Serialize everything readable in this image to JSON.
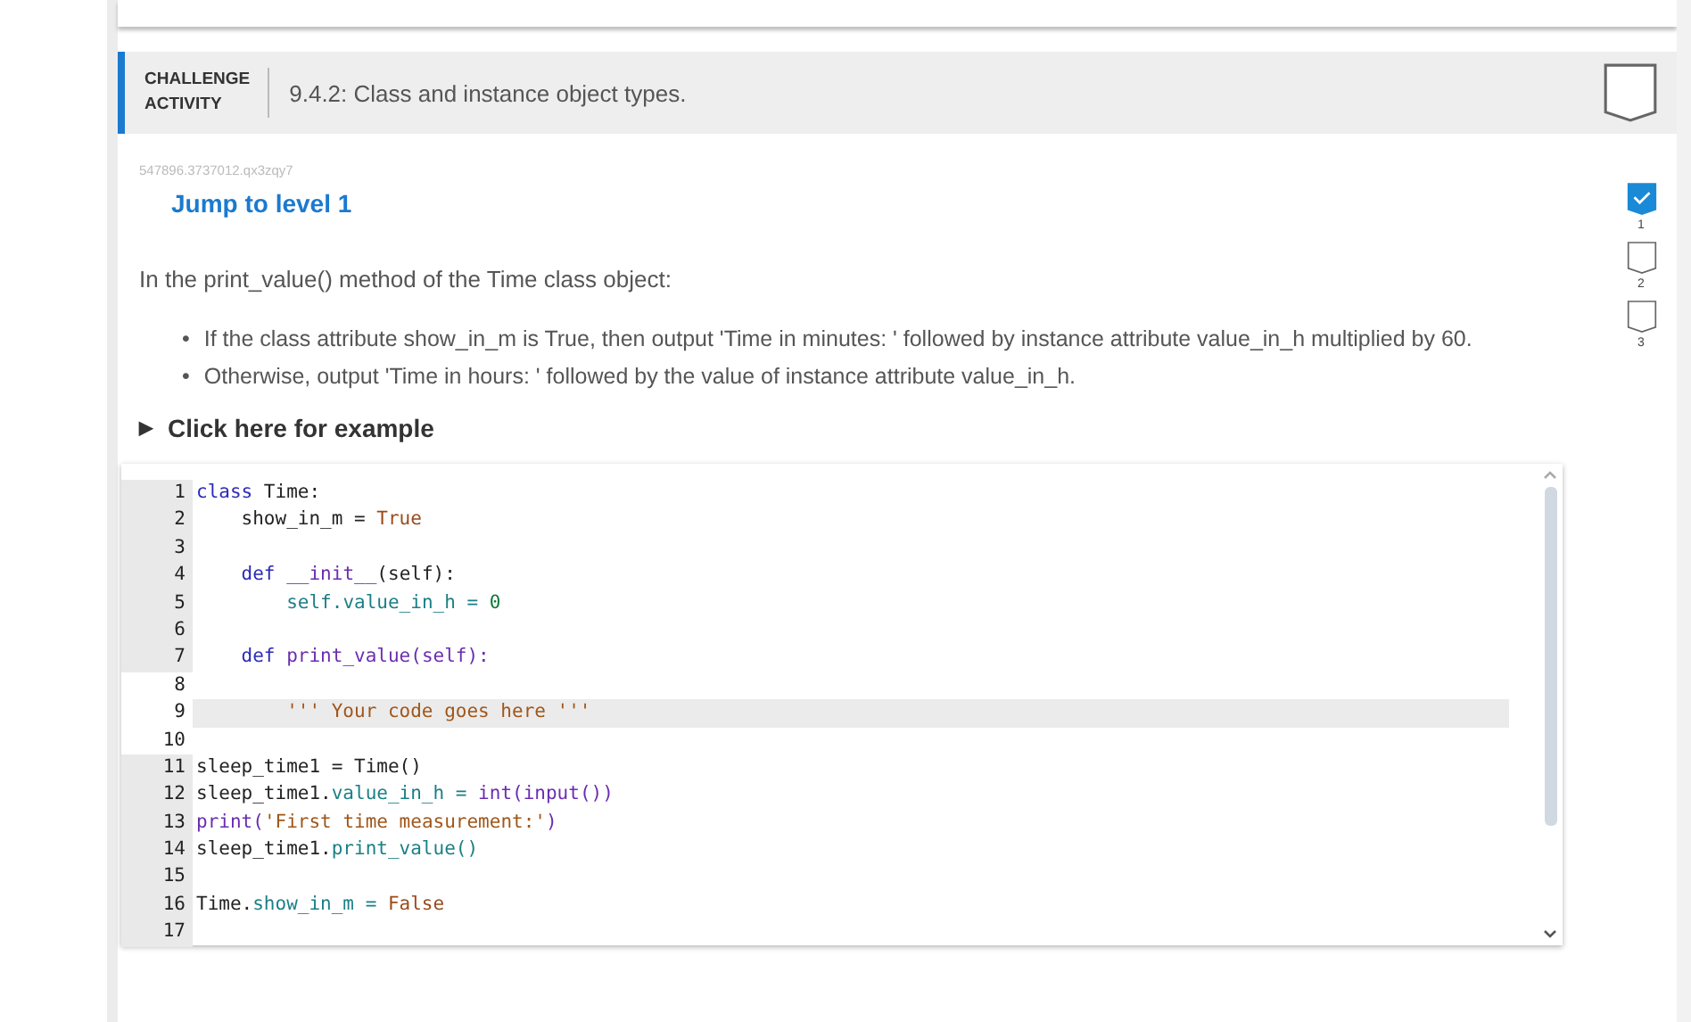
{
  "activity": {
    "label_top": "CHALLENGE",
    "label_bottom": "ACTIVITY",
    "title": "9.4.2: Class and instance object types.",
    "completed": false
  },
  "activity_id": "547896.3737012.qx3zqy7",
  "jump_link": "Jump to level 1",
  "levels": [
    {
      "number": "1",
      "checked": true
    },
    {
      "number": "2",
      "checked": false
    },
    {
      "number": "3",
      "checked": false
    }
  ],
  "instructions": {
    "intro": "In the print_value() method of the Time class object:",
    "bullets": [
      {
        "marker": "•",
        "text": "If the class attribute show_in_m is True, then output 'Time in minutes: ' followed by instance attribute value_in_h multiplied by 60."
      },
      {
        "marker": "•",
        "text": "Otherwise, output 'Time in hours: ' followed by the value of instance attribute value_in_h."
      }
    ]
  },
  "example_toggle": {
    "arrow": "▶",
    "label": "Click here for example",
    "expanded": false
  },
  "editor": {
    "lines": [
      {
        "number": "1",
        "editable": false,
        "active": false,
        "tokens": [
          {
            "text": "class",
            "kind": "keyword"
          },
          {
            "text": " Time:",
            "kind": "plain"
          }
        ]
      },
      {
        "number": "2",
        "editable": false,
        "active": false,
        "tokens": [
          {
            "text": "    show_in_m = ",
            "kind": "plain"
          },
          {
            "text": "True",
            "kind": "constant"
          }
        ]
      },
      {
        "number": "3",
        "editable": false,
        "active": false
      },
      {
        "number": "4",
        "editable": false,
        "active": false,
        "tokens": [
          {
            "text": "    def",
            "kind": "keyword"
          },
          {
            "text": " __init__",
            "kind": "function"
          },
          {
            "text": "(self):",
            "kind": "plain"
          }
        ]
      },
      {
        "number": "5",
        "editable": false,
        "active": false,
        "tokens": [
          {
            "text": "        self.",
            "kind": "attribute"
          },
          {
            "text": "value_in_h = ",
            "kind": "attribute"
          },
          {
            "text": "0",
            "kind": "number"
          }
        ]
      },
      {
        "number": "6",
        "editable": false,
        "active": false
      },
      {
        "number": "7",
        "editable": false,
        "active": false,
        "tokens": [
          {
            "text": "    def",
            "kind": "keyword"
          },
          {
            "text": " print_value",
            "kind": "function"
          },
          {
            "text": "(self):",
            "kind": "function"
          }
        ]
      },
      {
        "number": "8",
        "editable": true,
        "active": false
      },
      {
        "number": "9",
        "editable": true,
        "active": true,
        "tokens": [
          {
            "text": "        ''' Your code goes here '''",
            "kind": "string"
          }
        ]
      },
      {
        "number": "10",
        "editable": true,
        "active": false
      },
      {
        "number": "11",
        "editable": false,
        "active": false,
        "tokens": [
          {
            "text": "sleep_time1 = Time()",
            "kind": "plain"
          }
        ]
      },
      {
        "number": "12",
        "editable": false,
        "active": false,
        "tokens": [
          {
            "text": "sleep_time1.",
            "kind": "plain"
          },
          {
            "text": "value_in_h = ",
            "kind": "attribute"
          },
          {
            "text": "int(input())",
            "kind": "function"
          }
        ]
      },
      {
        "number": "13",
        "editable": false,
        "active": false,
        "tokens": [
          {
            "text": "print(",
            "kind": "function"
          },
          {
            "text": "'First time measurement:'",
            "kind": "string"
          },
          {
            "text": ")",
            "kind": "function"
          }
        ]
      },
      {
        "number": "14",
        "editable": false,
        "active": false,
        "tokens": [
          {
            "text": "sleep_time1.",
            "kind": "plain"
          },
          {
            "text": "print_value()",
            "kind": "attribute"
          }
        ]
      },
      {
        "number": "15",
        "editable": false,
        "active": false
      },
      {
        "number": "16",
        "editable": false,
        "active": false,
        "tokens": [
          {
            "text": "Time.",
            "kind": "plain"
          },
          {
            "text": "show_in_m = ",
            "kind": "attribute"
          },
          {
            "text": "False",
            "kind": "constant"
          }
        ]
      },
      {
        "number": "17",
        "editable": false,
        "active": false
      }
    ]
  }
}
